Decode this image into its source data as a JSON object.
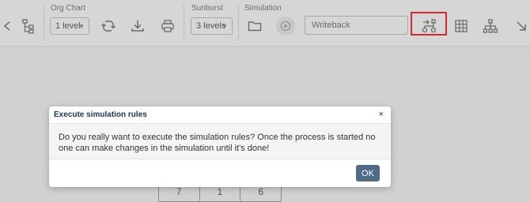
{
  "toolbar": {
    "org_chart": {
      "label": "Org Chart",
      "level_select": "1 level"
    },
    "sunburst": {
      "label": "Sunburst",
      "level_select": "3 levels"
    },
    "simulation": {
      "label": "Simulation",
      "writeback_value": "Writeback"
    },
    "icons": [
      "collapse-left-icon",
      "tree-structure-icon",
      "refresh-icon",
      "download-icon",
      "print-icon",
      "folder-icon",
      "play-icon",
      "execute-rules-icon",
      "table-icon",
      "hierarchy-icon",
      "arrow-down-right-icon"
    ]
  },
  "background_table": {
    "cells": [
      "7",
      "1",
      "6"
    ]
  },
  "dialog": {
    "title": "Execute simulation rules",
    "close": "×",
    "message": "Do you really want to execute the simulation rules? Once the process is started no one can make changes in the simulation until it's done!",
    "ok_label": "OK"
  },
  "colors": {
    "overlay_toolbar": "#d6d6d6",
    "dialog_header_text": "#1d3550",
    "ok_button": "#4f6b86",
    "highlight": "#d8272e"
  }
}
